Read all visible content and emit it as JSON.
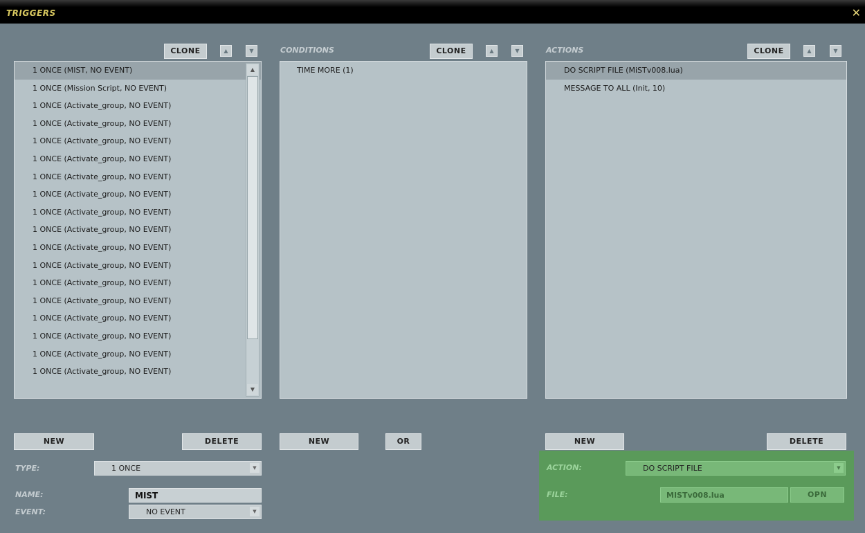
{
  "window": {
    "title": "TRIGGERS",
    "close_glyph": "✕"
  },
  "triggers": {
    "clone_label": "CLONE",
    "items": [
      "1 ONCE (MIST, NO EVENT)",
      "1 ONCE (Mission Script, NO EVENT)",
      "1 ONCE (Activate_group, NO EVENT)",
      "1 ONCE (Activate_group, NO EVENT)",
      "1 ONCE (Activate_group, NO EVENT)",
      "1 ONCE (Activate_group, NO EVENT)",
      "1 ONCE (Activate_group, NO EVENT)",
      "1 ONCE (Activate_group, NO EVENT)",
      "1 ONCE (Activate_group, NO EVENT)",
      "1 ONCE (Activate_group, NO EVENT)",
      "1 ONCE (Activate_group, NO EVENT)",
      "1 ONCE (Activate_group, NO EVENT)",
      "1 ONCE (Activate_group, NO EVENT)",
      "1 ONCE (Activate_group, NO EVENT)",
      "1 ONCE (Activate_group, NO EVENT)",
      "1 ONCE (Activate_group, NO EVENT)",
      "1 ONCE (Activate_group, NO EVENT)",
      "1 ONCE (Activate_group, NO EVENT)"
    ],
    "selected_index": 0,
    "new_label": "NEW",
    "delete_label": "DELETE",
    "type_label": "TYPE:",
    "type_value": "1 ONCE",
    "name_label": "NAME:",
    "name_value": "MIST",
    "event_label": "EVENT:",
    "event_value": "NO EVENT"
  },
  "conditions": {
    "header": "CONDITIONS",
    "clone_label": "CLONE",
    "items": [
      "TIME MORE (1)"
    ],
    "new_label": "NEW",
    "or_label": "OR"
  },
  "actions": {
    "header": "ACTIONS",
    "clone_label": "CLONE",
    "items": [
      "DO SCRIPT FILE (MiSTv008.lua)",
      "MESSAGE TO ALL (Init, 10)"
    ],
    "selected_index": 0,
    "new_label": "NEW",
    "delete_label": "DELETE",
    "action_label": "ACTION:",
    "action_value": "DO SCRIPT FILE",
    "file_label": "FILE:",
    "file_value": "MISTv008.lua",
    "open_label": "OPN"
  },
  "icons": {
    "up": "▲",
    "down": "▼",
    "caret": "▼"
  },
  "colors": {
    "background": "#6f7f88",
    "list": "#b6c2c7",
    "selection": "#98a4aa",
    "green_panel": "#5a9a5a",
    "title": "#d8c860"
  }
}
